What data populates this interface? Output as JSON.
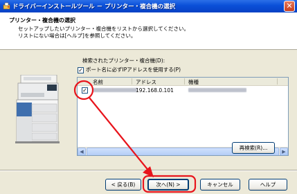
{
  "window": {
    "title": "ドライバーインストールツール － プリンター・複合機の選択"
  },
  "header": {
    "title": "プリンター・複合機の選択",
    "desc_line1": "セットアップしたいプリンター・複合機をリストから選択してください。",
    "desc_line2": "リストにない場合は[ヘルプ]を参照してください。"
  },
  "main": {
    "list_label": "検索されたプリンター・複合機(D):",
    "ip_checkbox_label": "ポート名に必ずIPアドレスを使用する(P)",
    "ip_checkbox_checked": true,
    "columns": [
      "名前",
      "アドレス",
      "機種"
    ],
    "rows": [
      {
        "checked": true,
        "address": "192.168.0.101"
      }
    ],
    "research_button": "再検索(R)..."
  },
  "footer": {
    "back_button": "< 戻る(B)",
    "next_button": "次へ(N) >",
    "cancel_button": "キャンセル",
    "help_button": "ヘルプ"
  },
  "colors": {
    "annotation": "#e8141c",
    "titlebar": "#0a4fd8",
    "dialog_bg": "#ece9d8"
  }
}
